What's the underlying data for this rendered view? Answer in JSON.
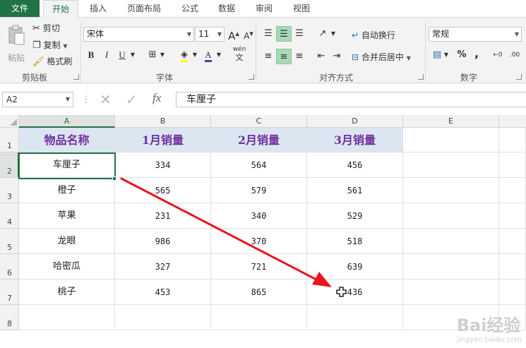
{
  "tabs": [
    "文件",
    "开始",
    "插入",
    "页面布局",
    "公式",
    "数据",
    "审阅",
    "视图"
  ],
  "ribbon": {
    "clipboard": {
      "paste": "粘贴",
      "cut": "剪切",
      "copy": "复制",
      "format_painter": "格式刷",
      "label": "剪贴板"
    },
    "font": {
      "name": "宋体",
      "size": "11",
      "bold": "B",
      "italic": "I",
      "underline": "U",
      "grow": "A",
      "shrink": "A",
      "wen": "wén",
      "wen_char": "文",
      "label": "字体"
    },
    "alignment": {
      "wrap": "自动换行",
      "merge": "合并后居中",
      "label": "对齐方式"
    },
    "number": {
      "format": "常规",
      "percent": "%",
      "comma": ",",
      "label": "数字"
    }
  },
  "formula_bar": {
    "name_box": "A2",
    "fx": "fx",
    "content": "车厘子"
  },
  "columns": [
    "A",
    "B",
    "C",
    "D",
    "E"
  ],
  "rows": [
    "1",
    "2",
    "3",
    "4",
    "5",
    "6",
    "7",
    "8"
  ],
  "sheet": {
    "header": [
      "物品名称",
      "1月销量",
      "2月销量",
      "3月销量"
    ],
    "data": [
      [
        "车厘子",
        "334",
        "564",
        "456"
      ],
      [
        "橙子",
        "565",
        "579",
        "561"
      ],
      [
        "苹果",
        "231",
        "340",
        "529"
      ],
      [
        "龙眼",
        "986",
        "370",
        "518"
      ],
      [
        "哈密瓜",
        "327",
        "721",
        "639"
      ],
      [
        "桃子",
        "453",
        "865",
        "436"
      ]
    ]
  },
  "watermark": {
    "text": "Bai经验",
    "sub": "jingyan.baidu.com"
  },
  "colors": {
    "accent": "#217346",
    "header_fill": "#dce6f1",
    "header_text": "#7030a0",
    "arrow": "#e8151b"
  }
}
